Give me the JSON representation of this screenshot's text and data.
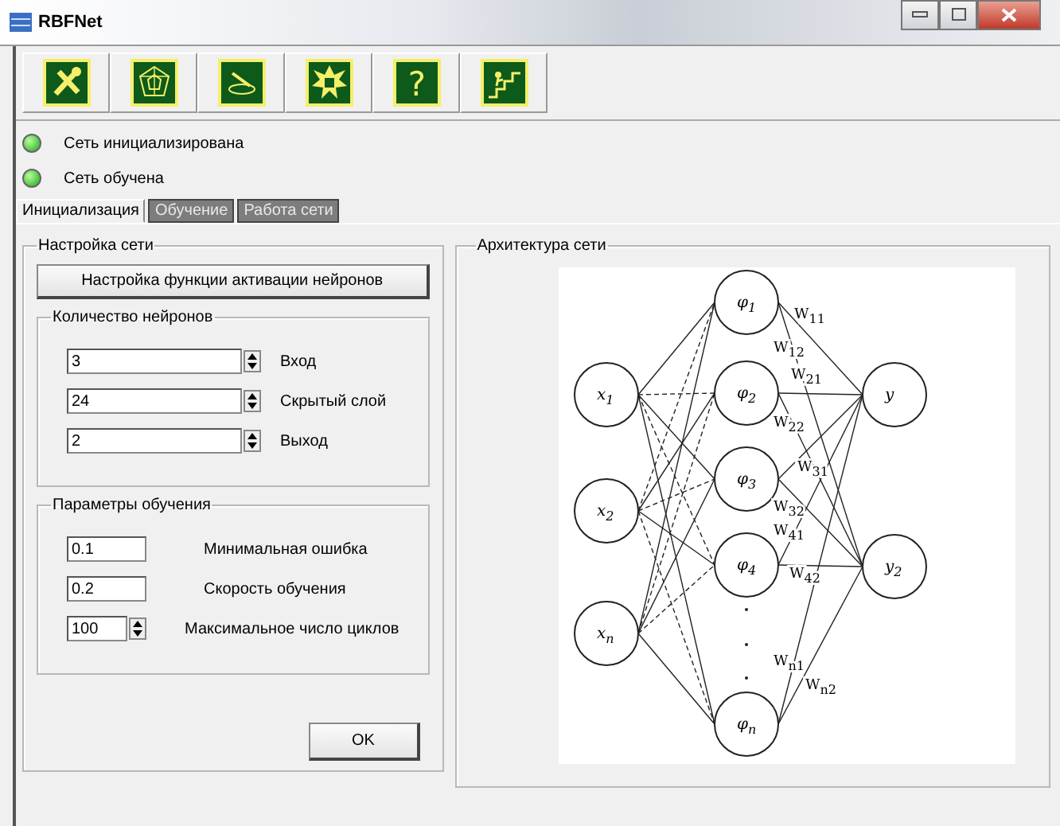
{
  "window": {
    "title": "RBFNet"
  },
  "toolbar": [
    {
      "kind": "tools"
    },
    {
      "kind": "web"
    },
    {
      "kind": "pen"
    },
    {
      "kind": "burst"
    },
    {
      "kind": "help",
      "glyph": "?"
    },
    {
      "kind": "stairs"
    }
  ],
  "status": [
    {
      "label": "Сеть инициализирована",
      "on": true
    },
    {
      "label": "Сеть обучена",
      "on": true
    }
  ],
  "tabs": [
    {
      "label": "Инициализация",
      "selected": true
    },
    {
      "label": "Обучение",
      "selected": false
    },
    {
      "label": "Работа сети",
      "selected": false
    }
  ],
  "network_settings": {
    "title": "Настройка сети",
    "activation_button": "Настройка функции активации нейронов",
    "neurons": {
      "title": "Количество нейронов",
      "fields": [
        {
          "kind": "spin",
          "value": "3",
          "label": "Вход"
        },
        {
          "kind": "spin",
          "value": "24",
          "label": "Скрытый слой"
        },
        {
          "kind": "spin",
          "value": "2",
          "label": "Выход"
        }
      ]
    },
    "training": {
      "title": "Параметры обучения",
      "fields": [
        {
          "kind": "text",
          "value": "0.1",
          "label": "Минимальная ошибка"
        },
        {
          "kind": "text",
          "value": "0.2",
          "label": "Скорость обучения"
        },
        {
          "kind": "spin",
          "value": "100",
          "label": "Максимальное число циклов"
        }
      ]
    },
    "ok_button": "OK"
  },
  "architecture": {
    "title": "Архитектура сети",
    "inputs": [
      {
        "name": "x",
        "sub": "1"
      },
      {
        "name": "x",
        "sub": "2"
      },
      {
        "name": "x",
        "sub": "n"
      }
    ],
    "hidden": [
      {
        "name": "φ",
        "sub": "1"
      },
      {
        "name": "φ",
        "sub": "2"
      },
      {
        "name": "φ",
        "sub": "3"
      },
      {
        "name": "φ",
        "sub": "4"
      },
      {
        "name": "φ",
        "sub": "n"
      }
    ],
    "outputs": [
      {
        "name": "y"
      },
      {
        "name": "y",
        "sub": "2"
      }
    ],
    "weights": [
      {
        "name": "W",
        "sub": "11"
      },
      {
        "name": "W",
        "sub": "12"
      },
      {
        "name": "W",
        "sub": "21"
      },
      {
        "name": "W",
        "sub": "22"
      },
      {
        "name": "W",
        "sub": "31"
      },
      {
        "name": "W",
        "sub": "32"
      },
      {
        "name": "W",
        "sub": "41"
      },
      {
        "name": "W",
        "sub": "42"
      },
      {
        "name": "W",
        "sub": "n1"
      },
      {
        "name": "W",
        "sub": "n2"
      }
    ]
  }
}
